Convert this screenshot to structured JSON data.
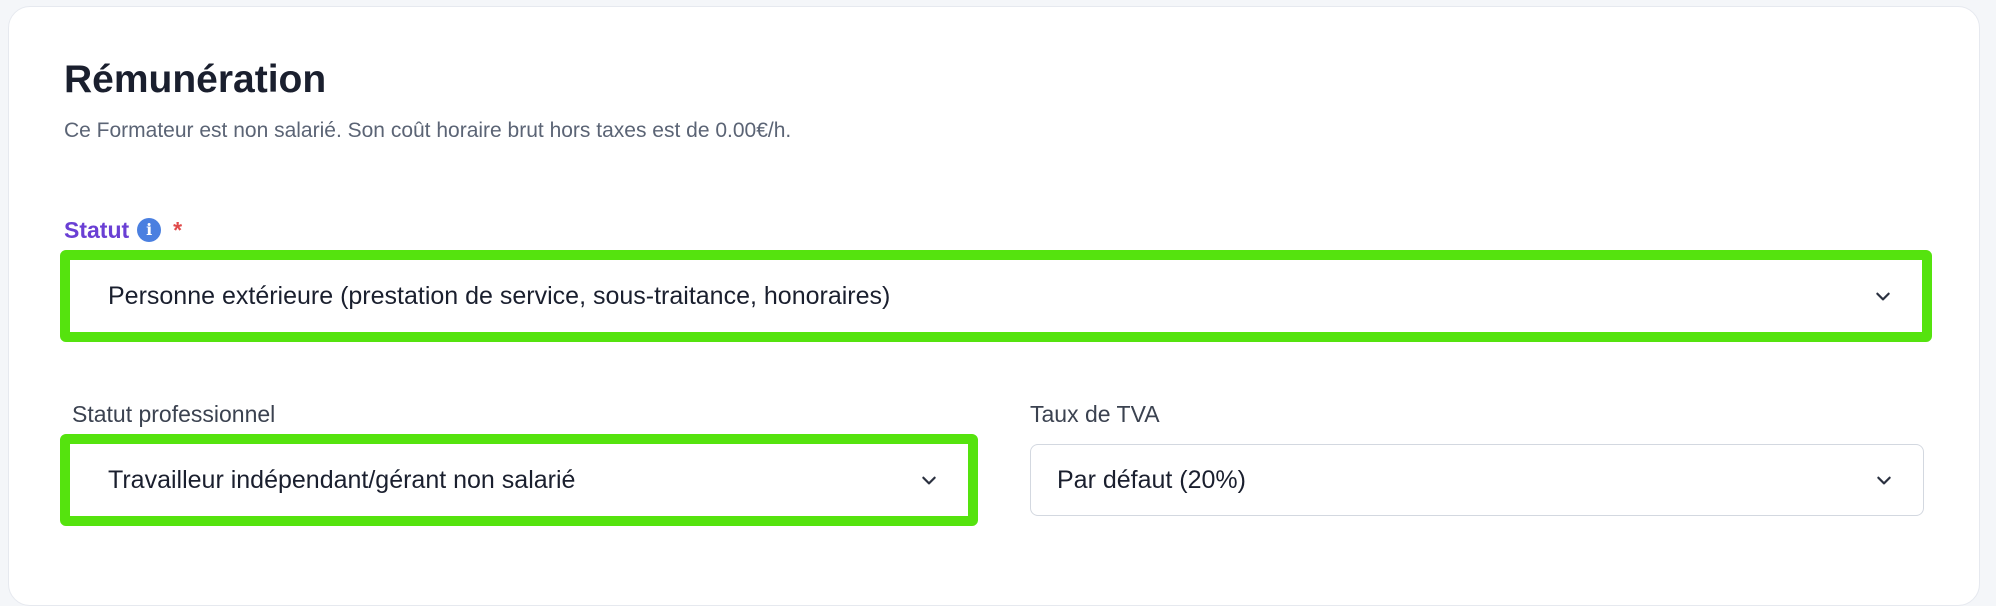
{
  "section": {
    "title": "Rémunération",
    "description": "Ce Formateur est non salarié. Son coût horaire brut hors taxes est de 0.00€/h."
  },
  "fields": {
    "statut": {
      "label": "Statut",
      "info_icon": "info-icon",
      "required_mark": "*",
      "value": "Personne extérieure (prestation de service, sous-traitance, honoraires)",
      "highlighted": true
    },
    "statut_professionnel": {
      "label": "Statut professionnel",
      "value": "Travailleur indépendant/gérant non salarié",
      "highlighted": true
    },
    "taux_tva": {
      "label": "Taux de TVA",
      "value": "Par défaut (20%)",
      "highlighted": false
    }
  },
  "colors": {
    "primary_label": "#6a3fd4",
    "info_icon": "#4a7fe0",
    "required": "#e04a4a",
    "highlight": "#55e30e"
  },
  "icons": {
    "dropdown": "chevron-down-icon"
  }
}
